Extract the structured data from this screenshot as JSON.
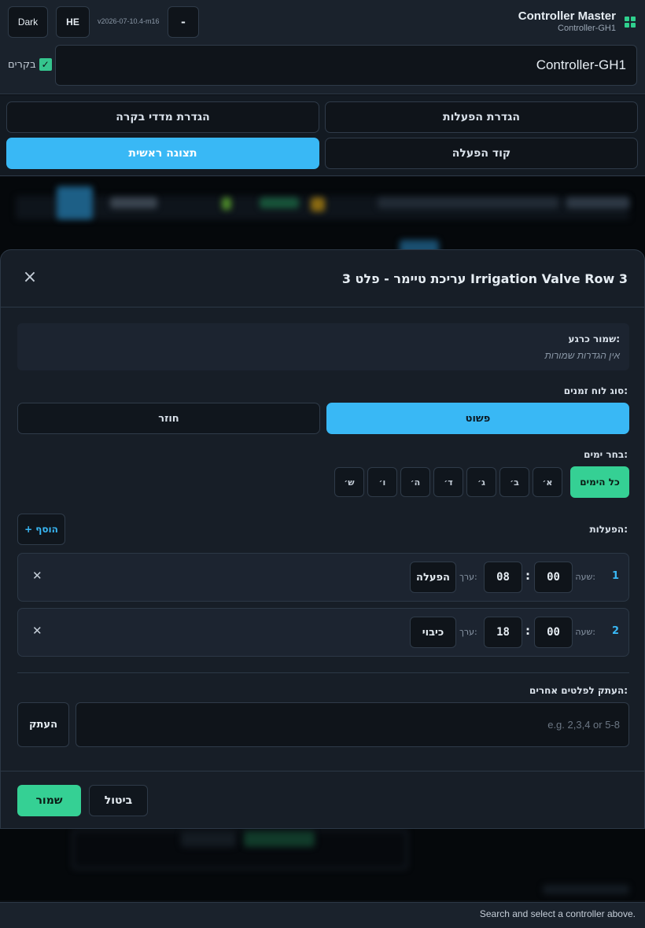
{
  "header": {
    "theme_label": "Dark",
    "lang_label": "HE",
    "version": "v2026-07-10.4-m16",
    "minus_label": "-",
    "app_title": "Controller Master",
    "app_subtitle": "Controller-GH1",
    "controller_value": "Controller-GH1",
    "cows_label": "בקרים"
  },
  "nav": {
    "actions_setup": "הגדרת הפעלות",
    "sensors_setup": "הגדרת מדדי בקרה",
    "activation_code": "קוד הפעלה",
    "main_view": "תצוגה ראשית"
  },
  "modal": {
    "title": "עריכת טיימר - פלט 3 Irrigation Valve Row 3",
    "saved_label": "שמור כרגע:",
    "saved_value": "אין הגדרות שמורות",
    "schedule_type_label": "סוג לוח זמנים:",
    "schedule_simple": "פשוט",
    "schedule_recurring": "חוזר",
    "days_label": "בחר ימים:",
    "all_days": "כל הימים",
    "days": [
      "א׳",
      "ב׳",
      "ג׳",
      "ד׳",
      "ה׳",
      "ו׳",
      "ש׳"
    ],
    "actions_label": "הפעלות:",
    "add_label": "+ הוסף",
    "hour_label": "שעה:",
    "value_label": "ערך:",
    "rows": [
      {
        "num": "1",
        "hour": "08",
        "minute": "00",
        "value": "הפעלה"
      },
      {
        "num": "2",
        "hour": "18",
        "minute": "00",
        "value": "כיבוי"
      }
    ],
    "copy_label": "העתק לפלטים אחרים:",
    "copy_placeholder": "e.g. 2,3,4 or 5-8",
    "copy_button": "העתק",
    "save_button": "שמור",
    "cancel_button": "ביטול"
  },
  "footer": {
    "status": "Search and select a controller above."
  },
  "colors": {
    "accent_blue": "#39b8f5",
    "accent_green": "#35d094",
    "background": "#0b0f14"
  }
}
